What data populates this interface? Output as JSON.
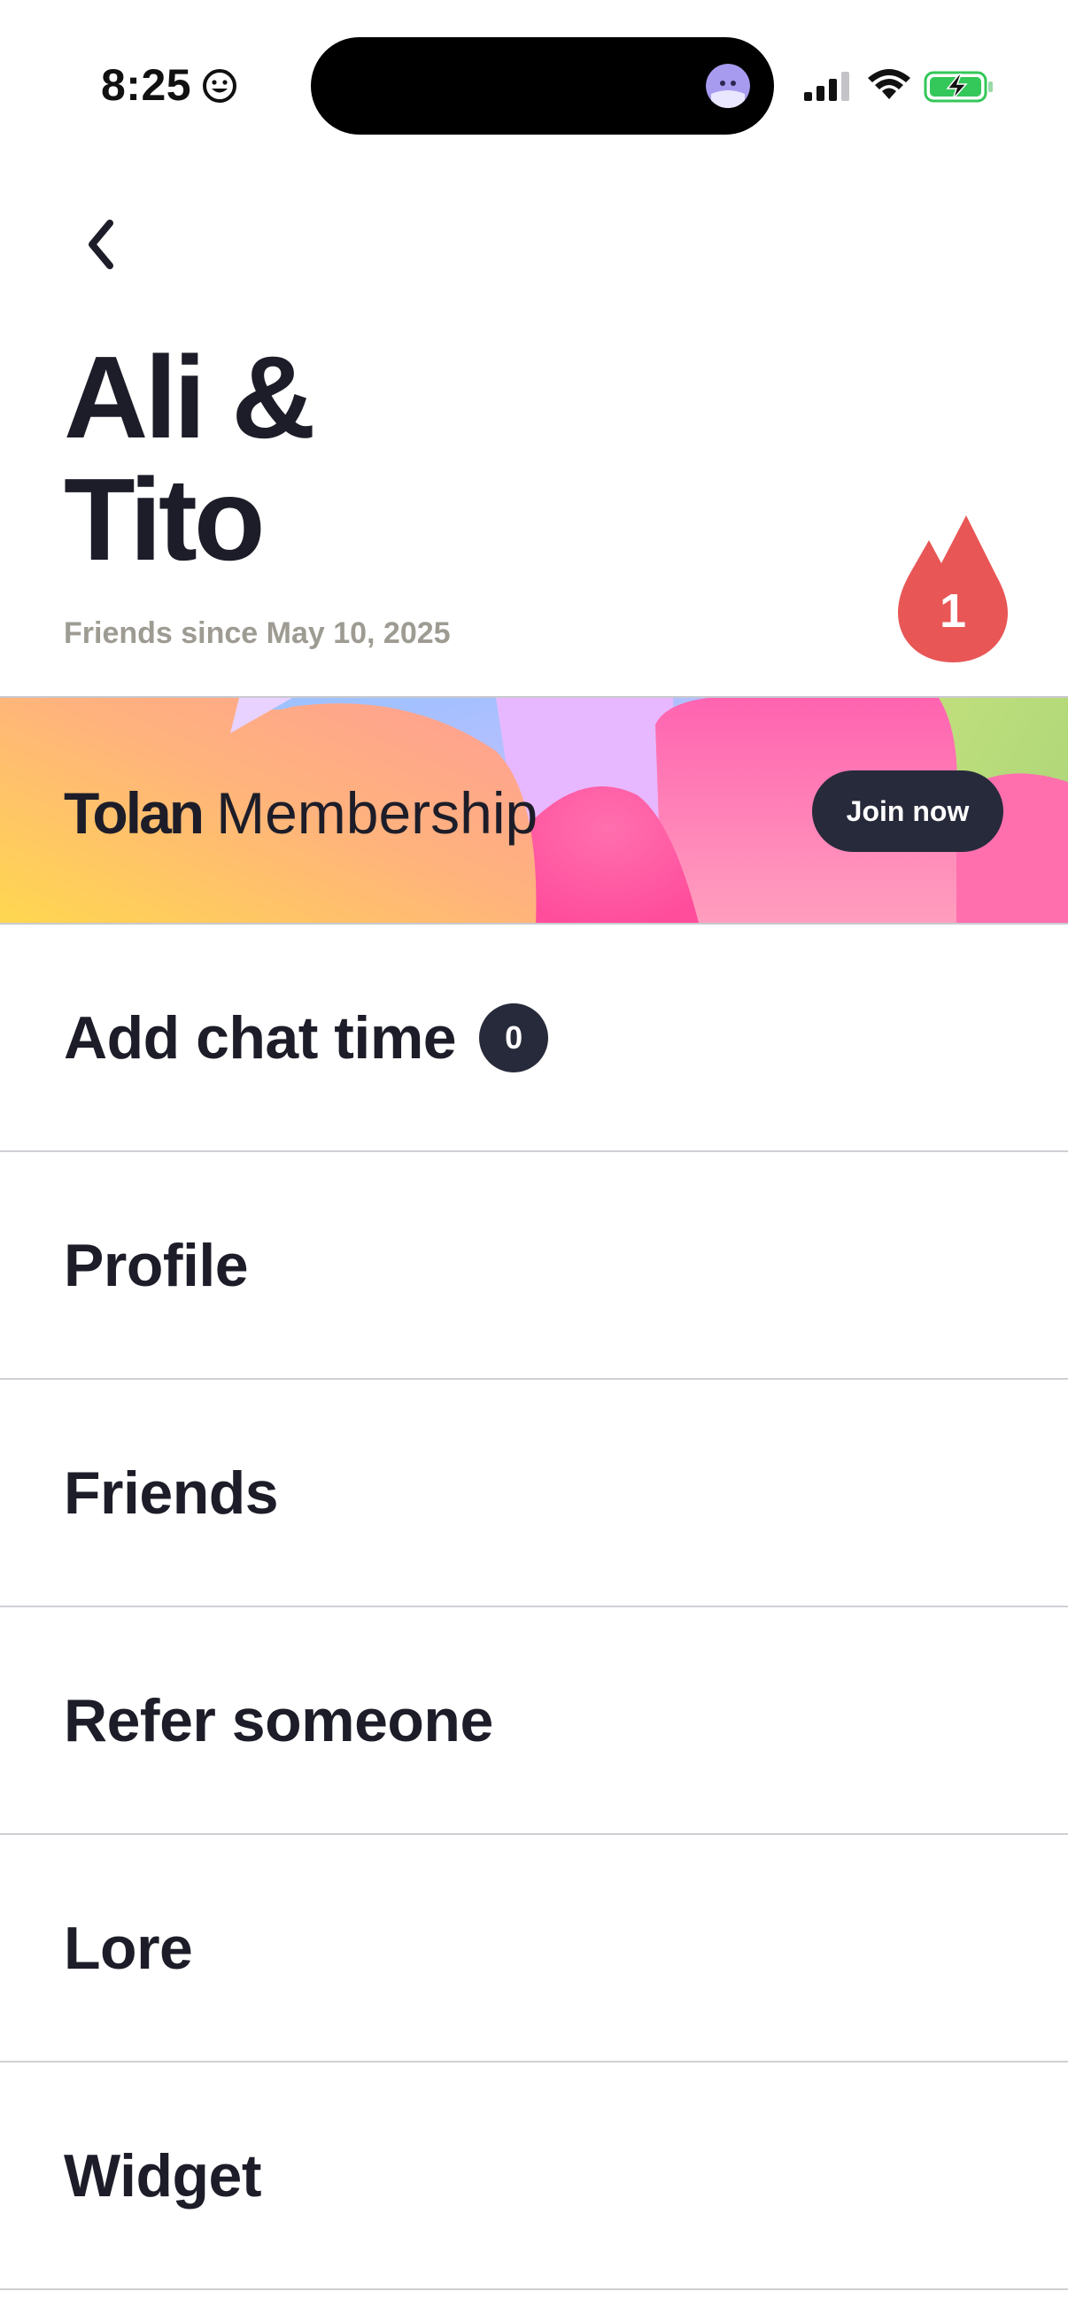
{
  "status_bar": {
    "time": "8:25",
    "icons": [
      "smiley-face-icon",
      "avatar",
      "cellular-signal-icon",
      "wifi-icon",
      "battery-charging-icon"
    ]
  },
  "header": {
    "title_line1": "Ali &",
    "title_line2": "Tito",
    "subtitle": "Friends since May 10, 2025",
    "streak_count": "1",
    "back_icon": "chevron-left-icon"
  },
  "membership": {
    "brand": "Tolan",
    "label": "Membership",
    "button_label": "Join now"
  },
  "menu": {
    "items": [
      {
        "label": "Add chat time",
        "badge": "0"
      },
      {
        "label": "Profile"
      },
      {
        "label": "Friends"
      },
      {
        "label": "Refer someone"
      },
      {
        "label": "Lore"
      },
      {
        "label": "Widget"
      }
    ]
  },
  "colors": {
    "text": "#1d1d29",
    "muted": "#9e9b93",
    "button_dark": "#272a3a",
    "streak_red": "#e85656",
    "divider": "#cfcfd4"
  }
}
